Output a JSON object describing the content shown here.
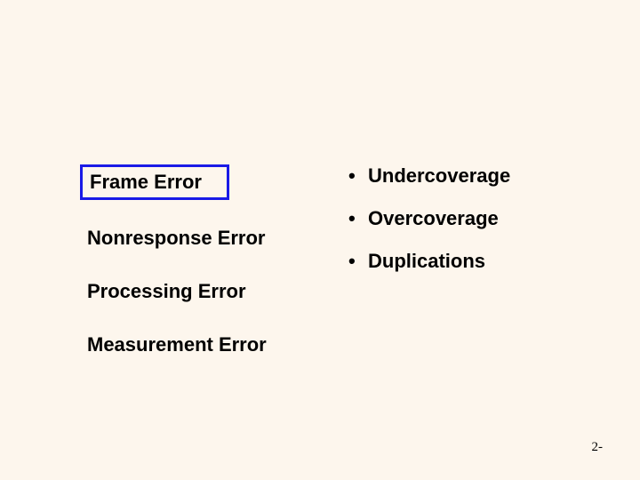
{
  "left": {
    "items": [
      {
        "label": "Frame Error",
        "highlighted": true
      },
      {
        "label": "Nonresponse Error",
        "highlighted": false
      },
      {
        "label": "Processing Error",
        "highlighted": false
      },
      {
        "label": "Measurement Error",
        "highlighted": false
      }
    ]
  },
  "right": {
    "bullets": [
      "Undercoverage",
      "Overcoverage",
      "Duplications"
    ]
  },
  "page_number": "2-"
}
